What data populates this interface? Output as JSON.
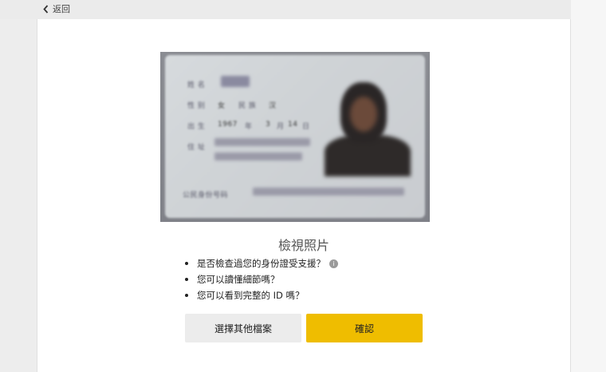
{
  "nav": {
    "back_label": "返回"
  },
  "id_card": {
    "fields": [
      {
        "label": "姓 名",
        "value": ""
      },
      {
        "label": "性 别",
        "value": "女"
      },
      {
        "label": "民 族",
        "value": "汉"
      },
      {
        "label": "出 生",
        "value": "1967"
      },
      {
        "label": "年",
        "value": "年"
      },
      {
        "label": "月",
        "value": "3"
      },
      {
        "label": "日",
        "value": "14"
      },
      {
        "label": "住 址",
        "value": ""
      },
      {
        "label": "公民身份号码",
        "value": ""
      }
    ]
  },
  "review": {
    "title": "檢視照片",
    "checklist": [
      "是否檢查過您的身份證受支援？",
      "您可以讀懂細節嗎？",
      "您可以看到完整的 ID 嗎？"
    ]
  },
  "buttons": {
    "choose_other": "選擇其他檔案",
    "confirm": "確認"
  },
  "colors": {
    "confirm": "#efbd00",
    "secondary": "#ececec"
  }
}
